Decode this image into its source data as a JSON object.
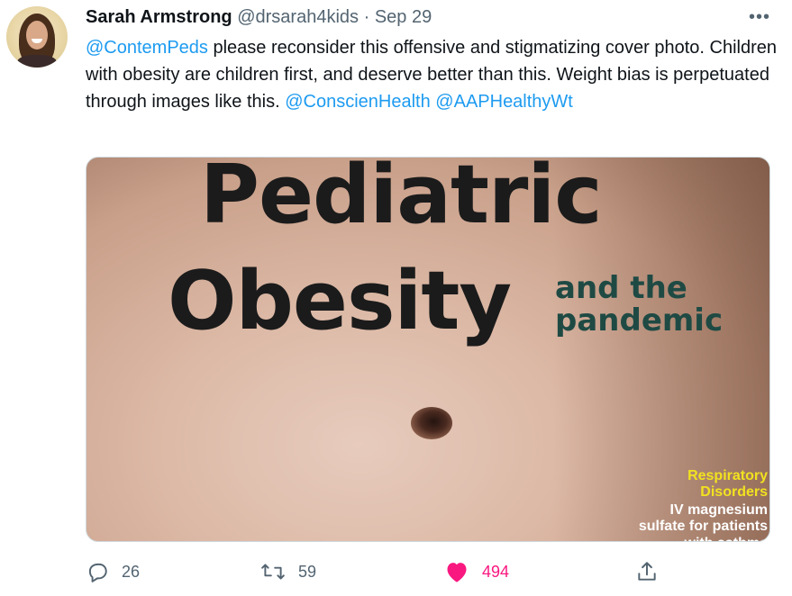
{
  "tweet": {
    "author_name": "Sarah Armstrong",
    "handle": "@drsarah4kids",
    "separator": "·",
    "date": "Sep 29",
    "more_label": "•••",
    "text": {
      "mention1": "@ContemPeds",
      "body": " please reconsider this offensive and stigmatizing cover photo. Children with obesity are children first, and deserve better than this. Weight bias is perpetuated through images like this. ",
      "mention2": "@ConscienHealth",
      "mention3": "@AAPHealthyWt"
    },
    "media": {
      "headline_line1": "Pediatric",
      "headline_line2": "Obesity",
      "subhead_line1": "and the",
      "subhead_line2": "pandemic",
      "side_line1": "Respiratory",
      "side_line2": "Disorders",
      "side_line3": "IV magnesium",
      "side_line4": "sulfate for patients",
      "side_line5": "with asthma"
    },
    "actions": {
      "reply_count": "26",
      "retweet_count": "59",
      "like_count": "494"
    },
    "colors": {
      "mention": "#1d9bf0",
      "like": "#f91880",
      "muted": "#536471"
    },
    "icons": [
      "reply-icon",
      "retweet-icon",
      "like-icon",
      "share-icon",
      "more-icon"
    ]
  }
}
